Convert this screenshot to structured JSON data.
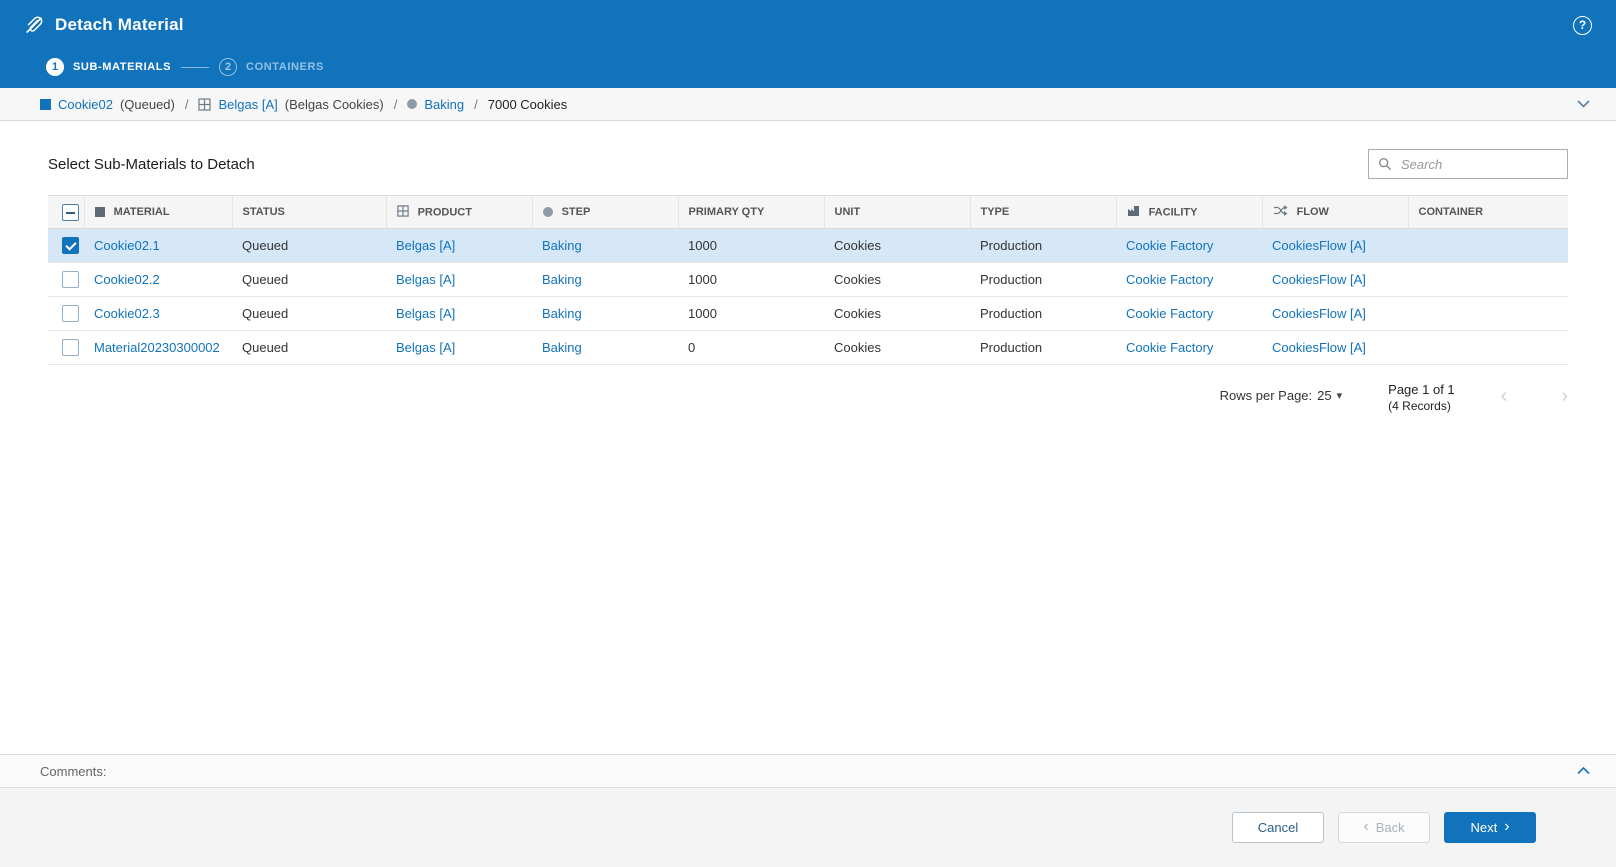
{
  "colors": {
    "primary_blue": "#1173BC",
    "link_blue": "#1173BC",
    "selected_row": "#D6E8F7",
    "table_header_bg": "#F5F5F5"
  },
  "icons": {
    "help": "?",
    "chevron_left": "‹",
    "chevron_right": "›",
    "caret_down": "▾"
  },
  "header": {
    "title": "Detach Material"
  },
  "wizard": {
    "steps": [
      {
        "number": "1",
        "label": "SUB-MATERIALS"
      },
      {
        "number": "2",
        "label": "CONTAINERS"
      }
    ]
  },
  "breadcrumb": {
    "separator": "/",
    "material_label": "Cookie02",
    "material_status": "(Queued)",
    "product_label": "Belgas [A]",
    "product_name": "(Belgas Cookies)",
    "step_label": "Baking",
    "quantity": "7000 Cookies"
  },
  "main": {
    "title": "Select Sub-Materials to Detach",
    "search_placeholder": "Search"
  },
  "table": {
    "columns": [
      "MATERIAL",
      "STATUS",
      "PRODUCT",
      "STEP",
      "PRIMARY QTY",
      "UNIT",
      "TYPE",
      "FACILITY",
      "FLOW",
      "CONTAINER"
    ],
    "rows": [
      {
        "checked": true,
        "material": "Cookie02.1",
        "status": "Queued",
        "product": "Belgas [A]",
        "step": "Baking",
        "primary_qty": "1000",
        "unit": "Cookies",
        "type": "Production",
        "facility": "Cookie Factory",
        "flow": "CookiesFlow [A]",
        "container": ""
      },
      {
        "checked": false,
        "material": "Cookie02.2",
        "status": "Queued",
        "product": "Belgas [A]",
        "step": "Baking",
        "primary_qty": "1000",
        "unit": "Cookies",
        "type": "Production",
        "facility": "Cookie Factory",
        "flow": "CookiesFlow [A]",
        "container": ""
      },
      {
        "checked": false,
        "material": "Cookie02.3",
        "status": "Queued",
        "product": "Belgas [A]",
        "step": "Baking",
        "primary_qty": "1000",
        "unit": "Cookies",
        "type": "Production",
        "facility": "Cookie Factory",
        "flow": "CookiesFlow [A]",
        "container": ""
      },
      {
        "checked": false,
        "material": "Material20230300002",
        "status": "Queued",
        "product": "Belgas [A]",
        "step": "Baking",
        "primary_qty": "0",
        "unit": "Cookies",
        "type": "Production",
        "facility": "Cookie Factory",
        "flow": "CookiesFlow [A]",
        "container": ""
      }
    ]
  },
  "pagination": {
    "rows_per_page_label": "Rows per Page:",
    "rows_per_page_value": "25",
    "page_label": "Page 1 of 1",
    "records_label": "(4 Records)"
  },
  "comments": {
    "label": "Comments:"
  },
  "footer": {
    "cancel_label": "Cancel",
    "back_label": "Back",
    "next_label": "Next"
  }
}
